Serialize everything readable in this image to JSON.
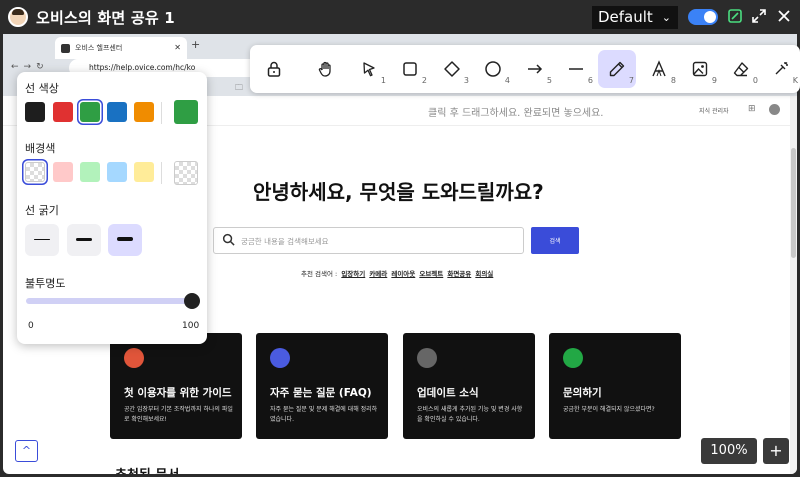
{
  "window": {
    "title": "오비스의 화면 공유 1",
    "preset": "Default",
    "colors": {
      "titlebar": "#2b2b2b",
      "toggle": "#3b82f6"
    },
    "icons": [
      "avatar",
      "toggle",
      "edit-icon",
      "fullscreen-icon",
      "close-icon"
    ]
  },
  "browser": {
    "tab_title": "오비스 헬프센터",
    "url": "https://help.ovice.com/hc/ko"
  },
  "site": {
    "header_hint": "클릭 후 드래그하세요. 완료되면 놓으세요.",
    "admin_link": "지식 관리자",
    "hero_title": "안녕하세요, 무엇을 도와드릴까요?",
    "search_placeholder": "궁금한 내용을 검색해보세요",
    "search_button": "검색",
    "popular_label": "추천 검색어 :",
    "popular_keywords": [
      "입장하기",
      "카메라",
      "레이아웃",
      "오브젝트",
      "화면공유",
      "회의실"
    ],
    "cards": [
      {
        "title": "첫 이용자를 위한 가이드",
        "desc": "공간 입장부터 기본 조작법까지 하나의 파일로 확인해보세요!",
        "icon": "laptop-icon",
        "icon_color": "#e0553a"
      },
      {
        "title": "자주 묻는 질문 (FAQ)",
        "desc": "자주 묻는 질문 및 문제 해결에 대해 정리하였습니다.",
        "icon": "lightbulb-icon",
        "icon_color": "#4a5be0"
      },
      {
        "title": "업데이트 소식",
        "desc": "오비스의 새롭게 추가된 기능 및 변경 사항을 확인하실 수 있습니다.",
        "icon": "news-icon",
        "icon_color": "#666666"
      },
      {
        "title": "문의하기",
        "desc": "궁금한 부분이 해결되지 않으셨다면?",
        "icon": "chat-icon",
        "icon_color": "#22a845"
      }
    ],
    "section_title": "추천된 문서",
    "accent": "#3a4cd9"
  },
  "zoom": {
    "label": "100%",
    "plus": "+"
  },
  "up_button": "^",
  "toolbar": {
    "tools": [
      {
        "name": "lock",
        "num": "",
        "active": true
      },
      {
        "name": "hand",
        "num": "",
        "active": false
      },
      {
        "name": "select",
        "num": "1",
        "active": false
      },
      {
        "name": "rectangle",
        "num": "2",
        "active": false
      },
      {
        "name": "diamond",
        "num": "3",
        "active": false
      },
      {
        "name": "ellipse",
        "num": "4",
        "active": false
      },
      {
        "name": "arrow",
        "num": "5",
        "active": false
      },
      {
        "name": "line",
        "num": "6",
        "active": false
      },
      {
        "name": "pencil",
        "num": "7",
        "active": true
      },
      {
        "name": "text",
        "num": "8",
        "active": false
      },
      {
        "name": "image",
        "num": "9",
        "active": false
      },
      {
        "name": "eraser",
        "num": "0",
        "active": false
      },
      {
        "name": "laser",
        "num": "K",
        "active": false
      }
    ]
  },
  "panel": {
    "stroke_color_label": "선 색상",
    "stroke_colors": [
      "#1e1e1e",
      "#e03131",
      "#2f9e44",
      "#1971c2",
      "#f08c00"
    ],
    "stroke_selected_index": 2,
    "stroke_current": "#2f9e44",
    "background_label": "배경색",
    "background_colors": [
      "transparent",
      "#ffc9c9",
      "#b2f2bb",
      "#a5d8ff",
      "#ffec99"
    ],
    "background_selected_index": 0,
    "width_label": "선 굵기",
    "width_selected_index": 2,
    "opacity_label": "불투명도",
    "opacity_value": 100,
    "opacity_min": "0",
    "opacity_max": "100"
  }
}
